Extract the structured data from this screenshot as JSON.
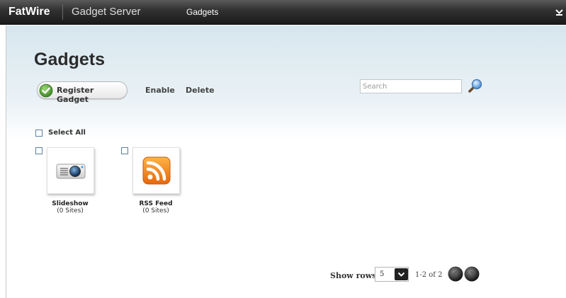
{
  "topbar": {
    "brand": "FatWire",
    "product": "Gadget Server",
    "nav_link": "Gadgets",
    "menu_icon": "chevron-down-icon"
  },
  "page": {
    "title": "Gadgets"
  },
  "toolbar": {
    "register_label": "Register Gadget",
    "register_icon": "checkmark-icon",
    "enable_label": "Enable",
    "delete_label": "Delete",
    "search_placeholder": "Search",
    "search_icon": "magnifier-icon"
  },
  "select_all_label": "Select All",
  "gadgets": [
    {
      "name": "Slideshow",
      "sites": "(0 Sites)",
      "icon": "projector-icon"
    },
    {
      "name": "RSS Feed",
      "sites": "(0 Sites)",
      "icon": "rss-icon"
    }
  ],
  "pagination": {
    "show_rows_label": "Show rows:",
    "rows_value": "5",
    "range_text": "1-2 of 2"
  },
  "colors": {
    "topbar": "#1a1a1a",
    "page_gradient_top": "#d7e6ee",
    "rss_orange": "#f08a1c",
    "check_green": "#5aa33a"
  }
}
